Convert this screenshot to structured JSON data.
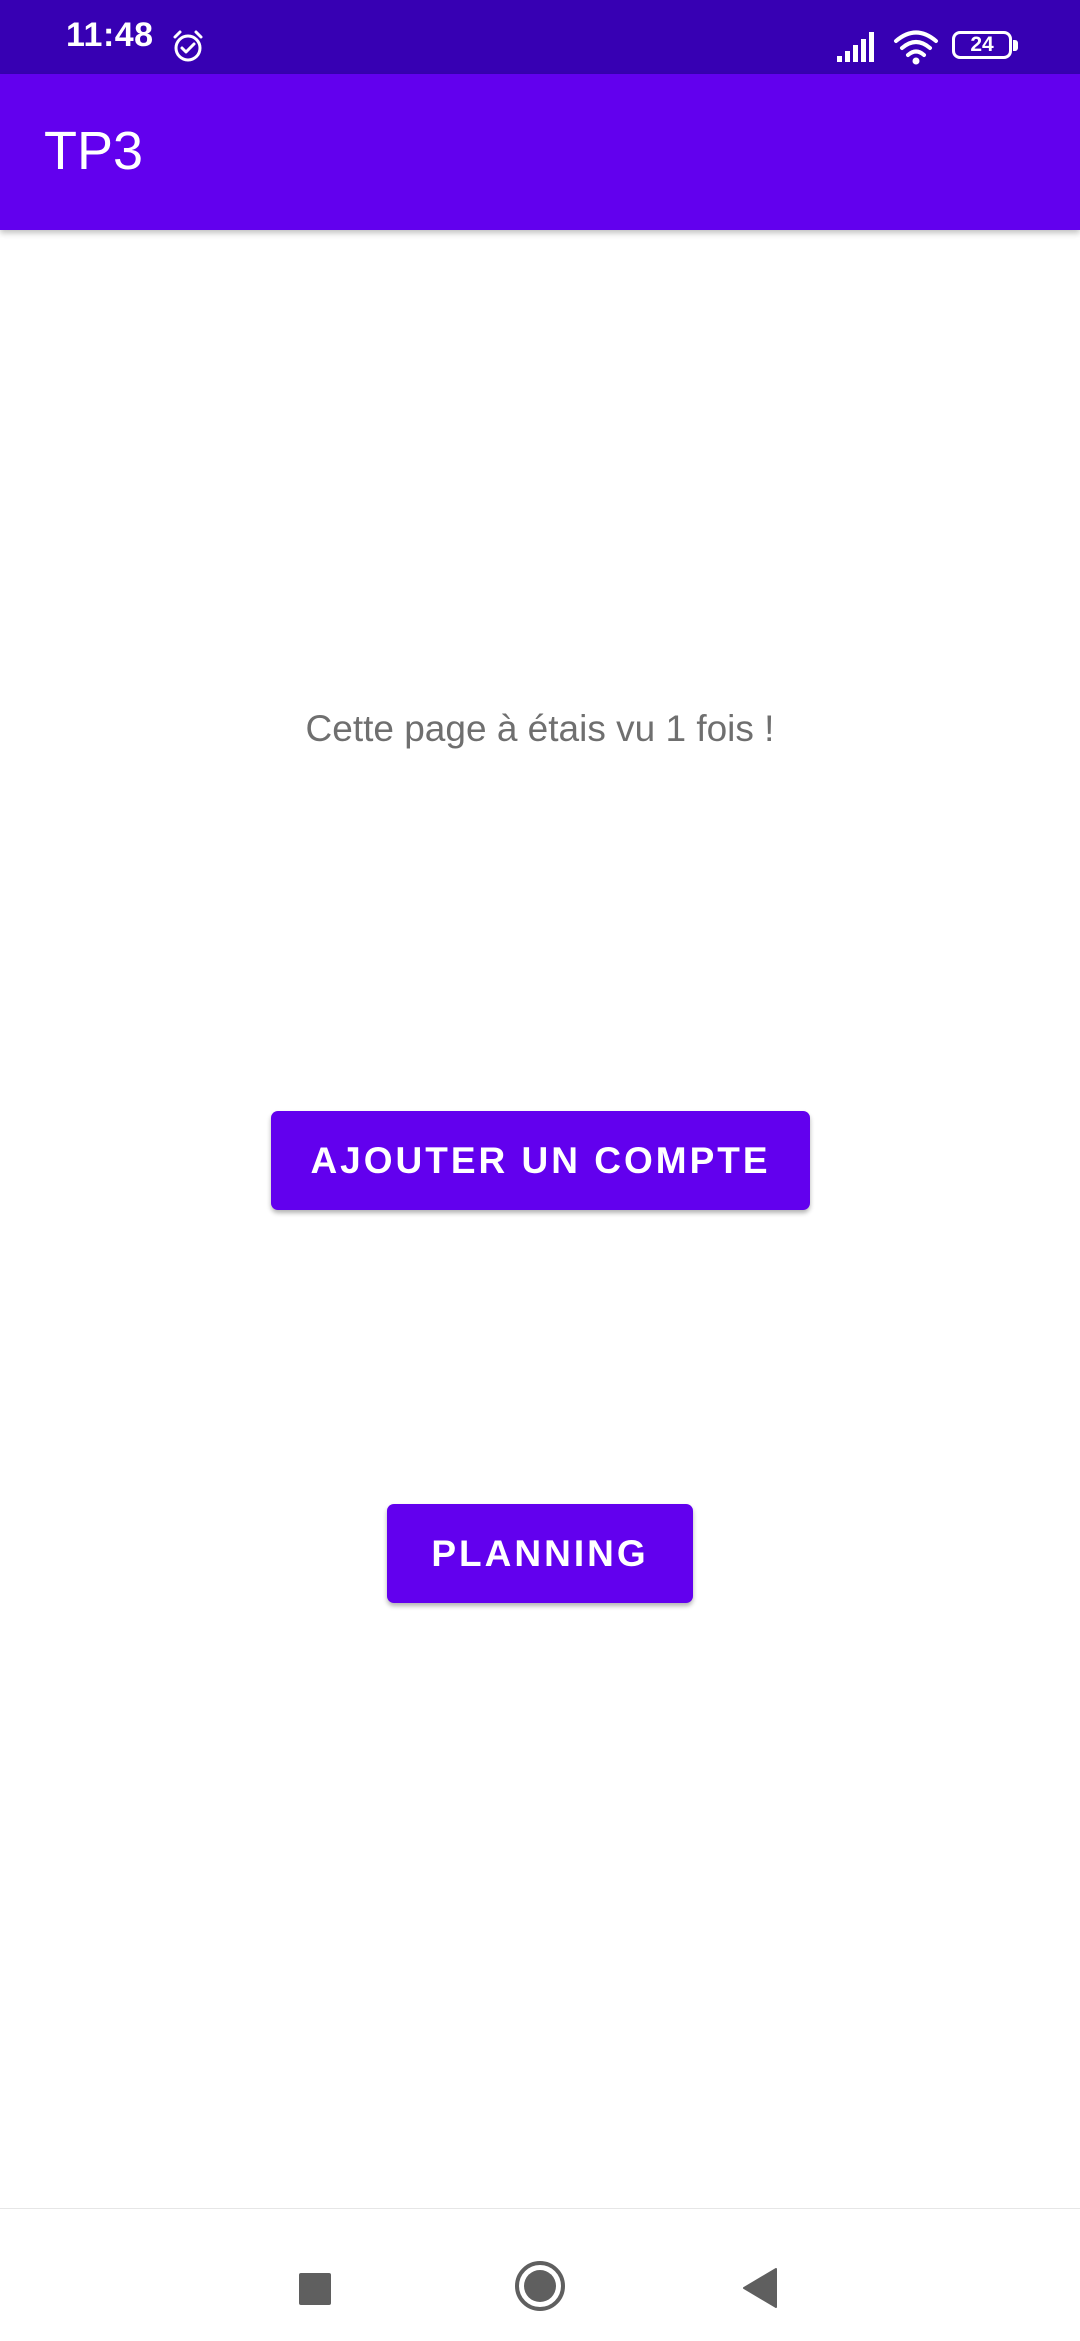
{
  "status_bar": {
    "time": "11:48",
    "battery_level": "24",
    "icons": [
      "alarm-icon",
      "signal-icon",
      "wifi-icon",
      "battery-icon"
    ]
  },
  "app_bar": {
    "title": "TP3"
  },
  "main": {
    "counter_text": "Cette page à étais vu 1 fois !",
    "add_account_label": "Ajouter un compte",
    "planning_label": "Planning"
  },
  "nav_bar": {
    "icons": [
      "recent-apps-icon",
      "home-icon",
      "back-icon"
    ]
  },
  "colors": {
    "status_bar": "#3700b3",
    "primary": "#6200ee",
    "text_secondary": "#6f6f6f",
    "background": "#ffffff"
  }
}
